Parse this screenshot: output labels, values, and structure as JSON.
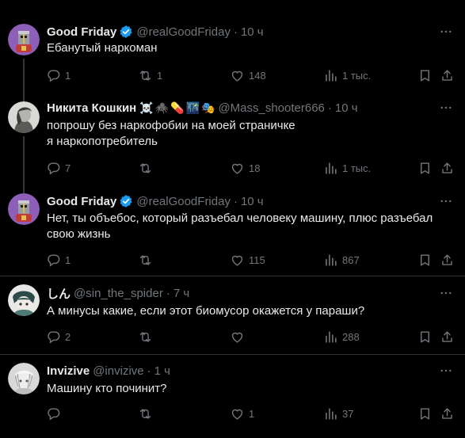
{
  "posts": [
    {
      "author": "Good Friday",
      "handle": "@realGoodFriday",
      "time": "10 ч",
      "verified": true,
      "emojis": [],
      "text": [
        "Ебанутый наркоман"
      ],
      "replies": "1",
      "reposts": "1",
      "likes": "148",
      "views": "1 тыс.",
      "avatar": "knight-avatar"
    },
    {
      "author": "Никита Кошкин",
      "handle": "@Mass_shooter666",
      "time": "10 ч",
      "verified": false,
      "emojis": [
        "☠️",
        "🕷️",
        "💊",
        "🌃",
        "🎭"
      ],
      "text": [
        "попрошу без наркофобии на моей страничке",
        "я наркопотребитель"
      ],
      "replies": "7",
      "reposts": "",
      "likes": "18",
      "views": "1 тыс.",
      "avatar": "portrait-avatar"
    },
    {
      "author": "Good Friday",
      "handle": "@realGoodFriday",
      "time": "10 ч",
      "verified": true,
      "emojis": [],
      "text": [
        "Нет, ты объебос, который разъебал человеку машину, плюс разъебал",
        "свою жизнь"
      ],
      "replies": "1",
      "reposts": "",
      "likes": "115",
      "views": "867",
      "avatar": "knight-avatar"
    },
    {
      "author": "しん",
      "handle": "@sin_the_spider",
      "time": "7 ч",
      "verified": false,
      "emojis": [],
      "text": [
        "А минусы какие, если этот биомусор окажется у параши?"
      ],
      "replies": "2",
      "reposts": "",
      "likes": "",
      "views": "288",
      "avatar": "anime-avatar"
    },
    {
      "author": "Invizive",
      "handle": "@invizive",
      "time": "1 ч",
      "verified": false,
      "emojis": [],
      "text": [
        "Машину кто починит?"
      ],
      "replies": "",
      "reposts": "",
      "likes": "1",
      "views": "37",
      "avatar": "sketch-avatar"
    }
  ],
  "separator": "·",
  "colors": {
    "background": "#000000",
    "text": "#e7e9ea",
    "muted": "#71767b",
    "verified": "#1d9bf0",
    "divider": "#2f3336"
  }
}
